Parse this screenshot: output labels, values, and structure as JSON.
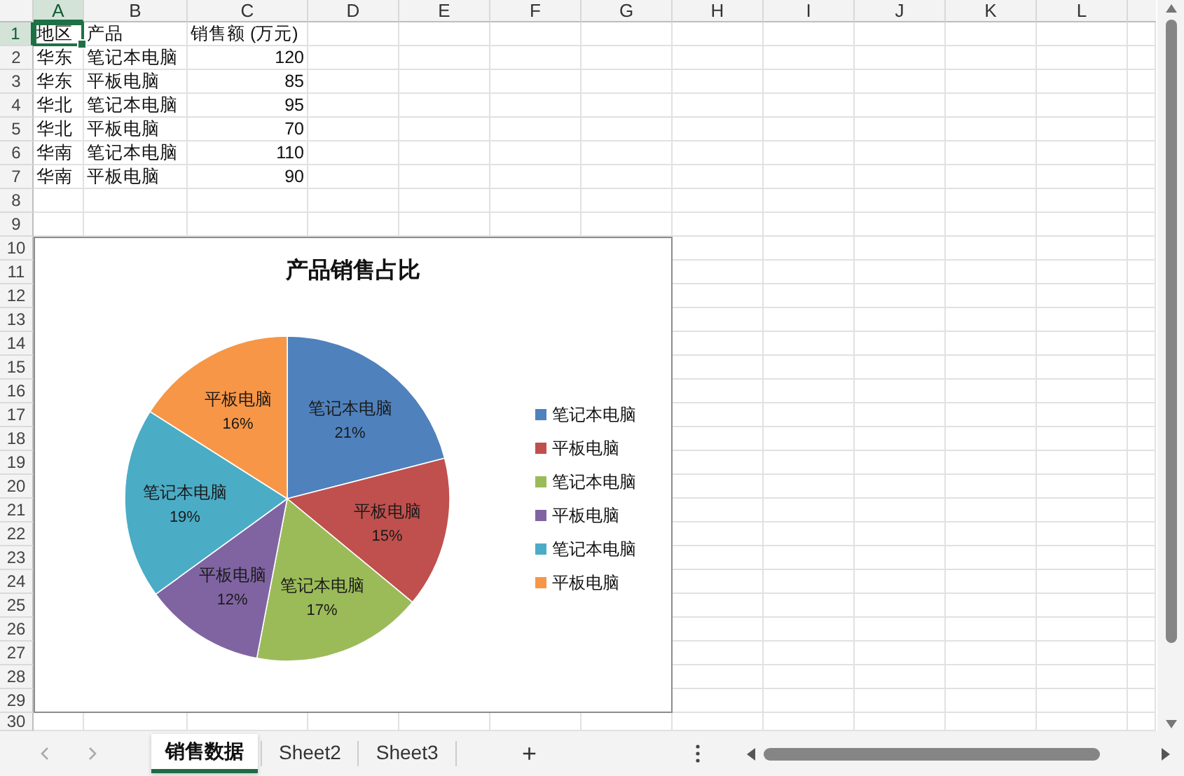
{
  "columns": [
    {
      "label": "A",
      "selected": true
    },
    {
      "label": "B",
      "selected": false
    },
    {
      "label": "C",
      "selected": false
    },
    {
      "label": "D",
      "selected": false
    },
    {
      "label": "E",
      "selected": false
    },
    {
      "label": "F",
      "selected": false
    },
    {
      "label": "G",
      "selected": false
    },
    {
      "label": "H",
      "selected": false
    },
    {
      "label": "I",
      "selected": false
    },
    {
      "label": "J",
      "selected": false
    },
    {
      "label": "K",
      "selected": false
    },
    {
      "label": "L",
      "selected": false
    }
  ],
  "rows": [
    {
      "number": "1",
      "selected": true,
      "cells": [
        {
          "text": "地区",
          "kind": "text",
          "selected": true
        },
        {
          "text": "产品",
          "kind": "text",
          "selected": false
        },
        {
          "text": "销售额 (万元)",
          "kind": "text",
          "selected": false
        }
      ]
    },
    {
      "number": "2",
      "selected": false,
      "cells": [
        {
          "text": "华东",
          "kind": "text",
          "selected": false
        },
        {
          "text": "笔记本电脑",
          "kind": "text",
          "selected": false
        },
        {
          "text": "120",
          "kind": "number",
          "selected": false
        }
      ]
    },
    {
      "number": "3",
      "selected": false,
      "cells": [
        {
          "text": "华东",
          "kind": "text",
          "selected": false
        },
        {
          "text": "平板电脑",
          "kind": "text",
          "selected": false
        },
        {
          "text": "85",
          "kind": "number",
          "selected": false
        }
      ]
    },
    {
      "number": "4",
      "selected": false,
      "cells": [
        {
          "text": "华北",
          "kind": "text",
          "selected": false
        },
        {
          "text": "笔记本电脑",
          "kind": "text",
          "selected": false
        },
        {
          "text": "95",
          "kind": "number",
          "selected": false
        }
      ]
    },
    {
      "number": "5",
      "selected": false,
      "cells": [
        {
          "text": "华北",
          "kind": "text",
          "selected": false
        },
        {
          "text": "平板电脑",
          "kind": "text",
          "selected": false
        },
        {
          "text": "70",
          "kind": "number",
          "selected": false
        }
      ]
    },
    {
      "number": "6",
      "selected": false,
      "cells": [
        {
          "text": "华南",
          "kind": "text",
          "selected": false
        },
        {
          "text": "笔记本电脑",
          "kind": "text",
          "selected": false
        },
        {
          "text": "110",
          "kind": "number",
          "selected": false
        }
      ]
    },
    {
      "number": "7",
      "selected": false,
      "cells": [
        {
          "text": "华南",
          "kind": "text",
          "selected": false
        },
        {
          "text": "平板电脑",
          "kind": "text",
          "selected": false
        },
        {
          "text": "90",
          "kind": "number",
          "selected": false
        }
      ]
    },
    {
      "number": "8",
      "selected": false,
      "cells": []
    },
    {
      "number": "9",
      "selected": false,
      "cells": []
    },
    {
      "number": "10",
      "selected": false,
      "cells": []
    },
    {
      "number": "11",
      "selected": false,
      "cells": []
    },
    {
      "number": "12",
      "selected": false,
      "cells": []
    },
    {
      "number": "13",
      "selected": false,
      "cells": []
    },
    {
      "number": "14",
      "selected": false,
      "cells": []
    },
    {
      "number": "15",
      "selected": false,
      "cells": []
    },
    {
      "number": "16",
      "selected": false,
      "cells": []
    },
    {
      "number": "17",
      "selected": false,
      "cells": []
    },
    {
      "number": "18",
      "selected": false,
      "cells": []
    },
    {
      "number": "19",
      "selected": false,
      "cells": []
    },
    {
      "number": "20",
      "selected": false,
      "cells": []
    },
    {
      "number": "21",
      "selected": false,
      "cells": []
    },
    {
      "number": "22",
      "selected": false,
      "cells": []
    },
    {
      "number": "23",
      "selected": false,
      "cells": []
    },
    {
      "number": "24",
      "selected": false,
      "cells": []
    },
    {
      "number": "25",
      "selected": false,
      "cells": []
    },
    {
      "number": "26",
      "selected": false,
      "cells": []
    },
    {
      "number": "27",
      "selected": false,
      "cells": []
    },
    {
      "number": "28",
      "selected": false,
      "cells": []
    },
    {
      "number": "29",
      "selected": false,
      "cells": []
    },
    {
      "number": "30",
      "selected": false,
      "cells": []
    }
  ],
  "chart": {
    "chart_data": {
      "type": "pie",
      "title": "产品销售占比",
      "categories": [
        "笔记本电脑",
        "平板电脑",
        "笔记本电脑",
        "平板电脑",
        "笔记本电脑",
        "平板电脑"
      ],
      "values": [
        21,
        15,
        17,
        12,
        19,
        16
      ],
      "data_labels": true,
      "value_labels": [
        "21%",
        "15%",
        "17%",
        "12%",
        "19%",
        "16%"
      ]
    },
    "legend": [
      {
        "label": "笔记本电脑",
        "color": "#4f81bd"
      },
      {
        "label": "平板电脑",
        "color": "#c0504d"
      },
      {
        "label": "笔记本电脑",
        "color": "#9bbb59"
      },
      {
        "label": "平板电脑",
        "color": "#8064a2"
      },
      {
        "label": "笔记本电脑",
        "color": "#4bacc6"
      },
      {
        "label": "平板电脑",
        "color": "#f79646"
      }
    ]
  },
  "sheet_tabs": [
    {
      "label": "销售数据",
      "selected": true
    },
    {
      "label": "Sheet2",
      "selected": false
    },
    {
      "label": "Sheet3",
      "selected": false
    }
  ],
  "add_sheet": "+"
}
